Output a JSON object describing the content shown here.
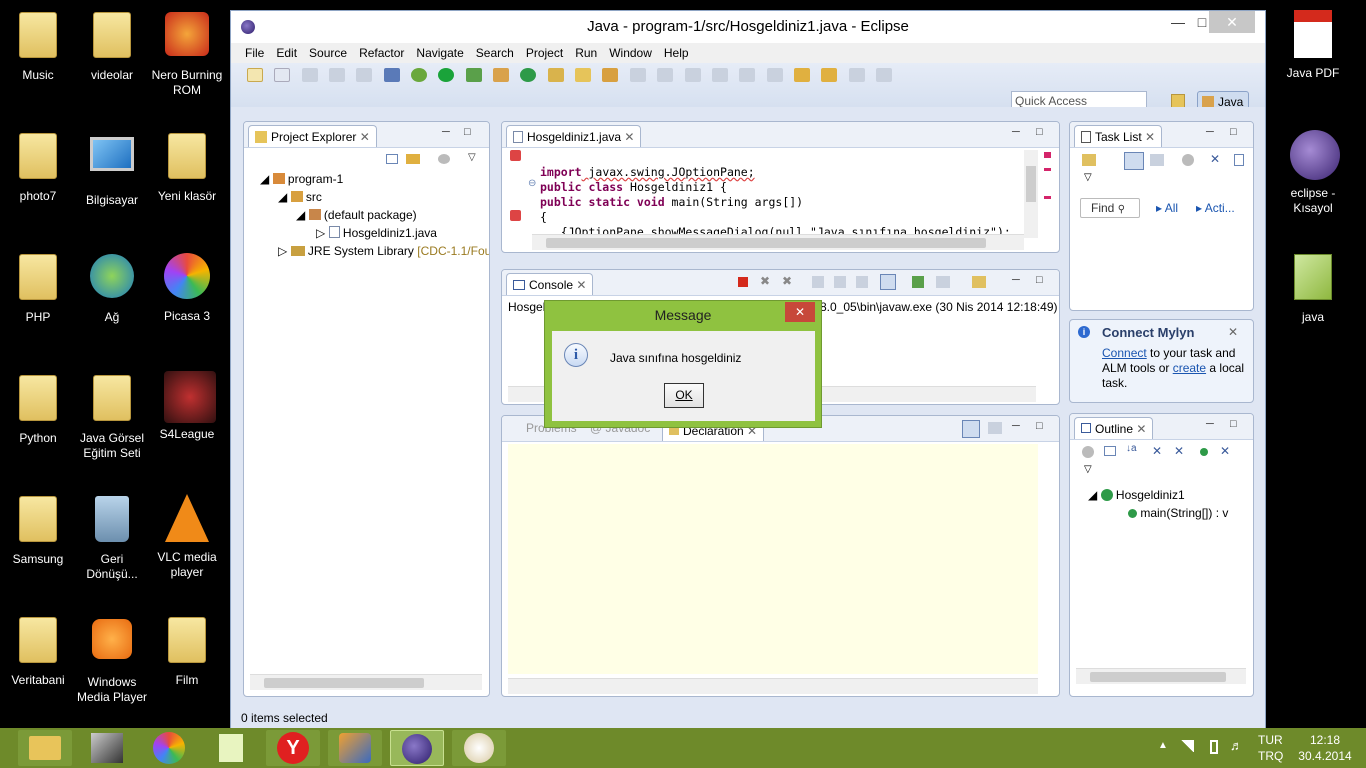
{
  "desktop_icons": [
    {
      "label": "Music"
    },
    {
      "label": "videolar"
    },
    {
      "label": "Nero Burning ROM"
    },
    {
      "label": "photo7"
    },
    {
      "label": "Bilgisayar"
    },
    {
      "label": "Yeni klasör"
    },
    {
      "label": "PHP"
    },
    {
      "label": "Ağ"
    },
    {
      "label": "Picasa 3"
    },
    {
      "label": "Python"
    },
    {
      "label": "Java Görsel Eğitim Seti"
    },
    {
      "label": "S4League"
    },
    {
      "label": "Samsung"
    },
    {
      "label": "Geri Dönüşü..."
    },
    {
      "label": "VLC media player"
    },
    {
      "label": "Veritabani"
    },
    {
      "label": "Windows Media Player"
    },
    {
      "label": "Film"
    },
    {
      "label": "Java PDF"
    },
    {
      "label": "eclipse - Kısayol"
    },
    {
      "label": "java"
    }
  ],
  "window": {
    "title": "Java - program-1/src/Hosgeldiniz1.java - Eclipse"
  },
  "menu": [
    "File",
    "Edit",
    "Source",
    "Refactor",
    "Navigate",
    "Search",
    "Project",
    "Run",
    "Window",
    "Help"
  ],
  "quick_access": {
    "placeholder": "Quick Access"
  },
  "perspective": "Java",
  "project_explorer": {
    "tab": "Project Explorer",
    "tree": {
      "project": "program-1",
      "src": "src",
      "package": "(default package)",
      "file": "Hosgeldiniz1.java",
      "jre": "JRE System Library",
      "jre_suffix": "[CDC-1.1/Fou"
    }
  },
  "editor": {
    "tab": "Hosgeldiniz1.java",
    "lines": {
      "l1a": "import",
      "l1b": " javax.swing.JOptionPane;",
      "l2a": "public class",
      "l2b": " Hosgeldiniz1 {",
      "l3a": "public static void",
      "l3b": " main(String args[])",
      "l4": "{",
      "l5": "   {JOptionPane.showMessageDialog(null,\"Java sınıfına hosgeldiniz\");"
    }
  },
  "console": {
    "tab": "Console",
    "text": "Hosgel",
    "text2": "8.0_05\\bin\\javaw.exe (30 Nis 2014 12:18:49)"
  },
  "bottom_tabs": {
    "problems": "Problems",
    "javadoc": "@ Javadoc",
    "declaration": "Declaration"
  },
  "task_list": {
    "tab": "Task List",
    "find": "Find",
    "all": "All",
    "acti": "Acti..."
  },
  "mylyn": {
    "title": "Connect Mylyn",
    "connect": "Connect",
    "text1": " to your task and ALM tools or ",
    "create": "create",
    "text2": " a local task."
  },
  "outline": {
    "tab": "Outline",
    "class": "Hosgeldiniz1",
    "method": "main(String[]) : v"
  },
  "status": {
    "text": "0 items selected"
  },
  "dialog": {
    "title": "Message",
    "message": "Java sınıfına hosgeldiniz",
    "ok": "OK"
  },
  "tray": {
    "lang1": "TUR",
    "lang2": "TRQ",
    "time": "12:18",
    "date": "30.4.2014"
  }
}
